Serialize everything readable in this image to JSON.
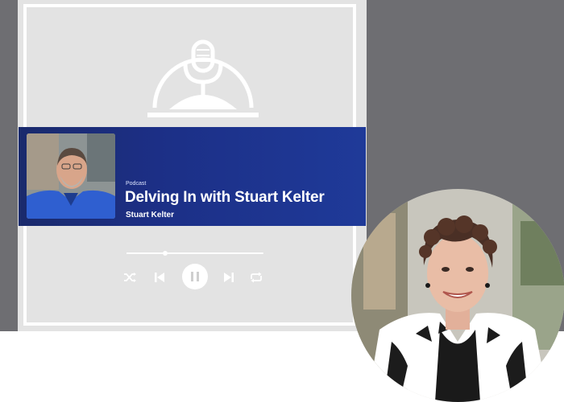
{
  "banner": {
    "kind_label": "Podcast",
    "title": "Delving In with Stuart Kelter",
    "author": "Stuart Kelter"
  },
  "player": {
    "progress_fraction": 0.28
  },
  "icons": {
    "logo": "microphone-dome-icon",
    "shuffle": "shuffle-icon",
    "previous": "skip-previous-icon",
    "pause": "pause-icon",
    "next": "skip-next-icon",
    "repeat": "repeat-icon"
  },
  "colors": {
    "banner_blue": "#1f3a99",
    "card_gray": "#e3e3e3",
    "backdrop_gray": "#6e6e72"
  }
}
